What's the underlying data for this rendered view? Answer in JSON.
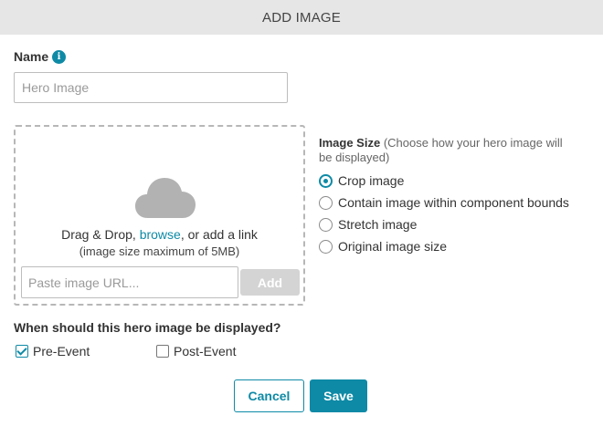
{
  "dialog": {
    "title": "ADD IMAGE"
  },
  "name_field": {
    "label": "Name",
    "info_icon": "info-icon",
    "info_glyph": "i",
    "placeholder": "Hero Image",
    "value": ""
  },
  "upload": {
    "icon": "cloud-icon",
    "drag_text_before": "Drag & Drop, ",
    "browse_label": "browse",
    "drag_text_after": ", or add a link",
    "size_note": "(image size maximum of 5MB)",
    "url_placeholder": "Paste image URL...",
    "url_value": "",
    "add_label": "Add"
  },
  "image_size": {
    "heading": "Image Size",
    "hint": " (Choose how your hero image will be displayed)",
    "options": [
      {
        "label": "Crop image",
        "checked": true
      },
      {
        "label": "Contain image within component bounds",
        "checked": false
      },
      {
        "label": "Stretch image",
        "checked": false
      },
      {
        "label": "Original image size",
        "checked": false
      }
    ]
  },
  "display": {
    "question": "When should this hero image be displayed?",
    "pre_event": {
      "label": "Pre-Event",
      "checked": true
    },
    "post_event": {
      "label": "Post-Event",
      "checked": false
    }
  },
  "actions": {
    "cancel_label": "Cancel",
    "save_label": "Save"
  },
  "colors": {
    "accent": "#0e8aa6",
    "header_bg": "#e6e6e6",
    "disabled_button": "#d4d4d4"
  }
}
